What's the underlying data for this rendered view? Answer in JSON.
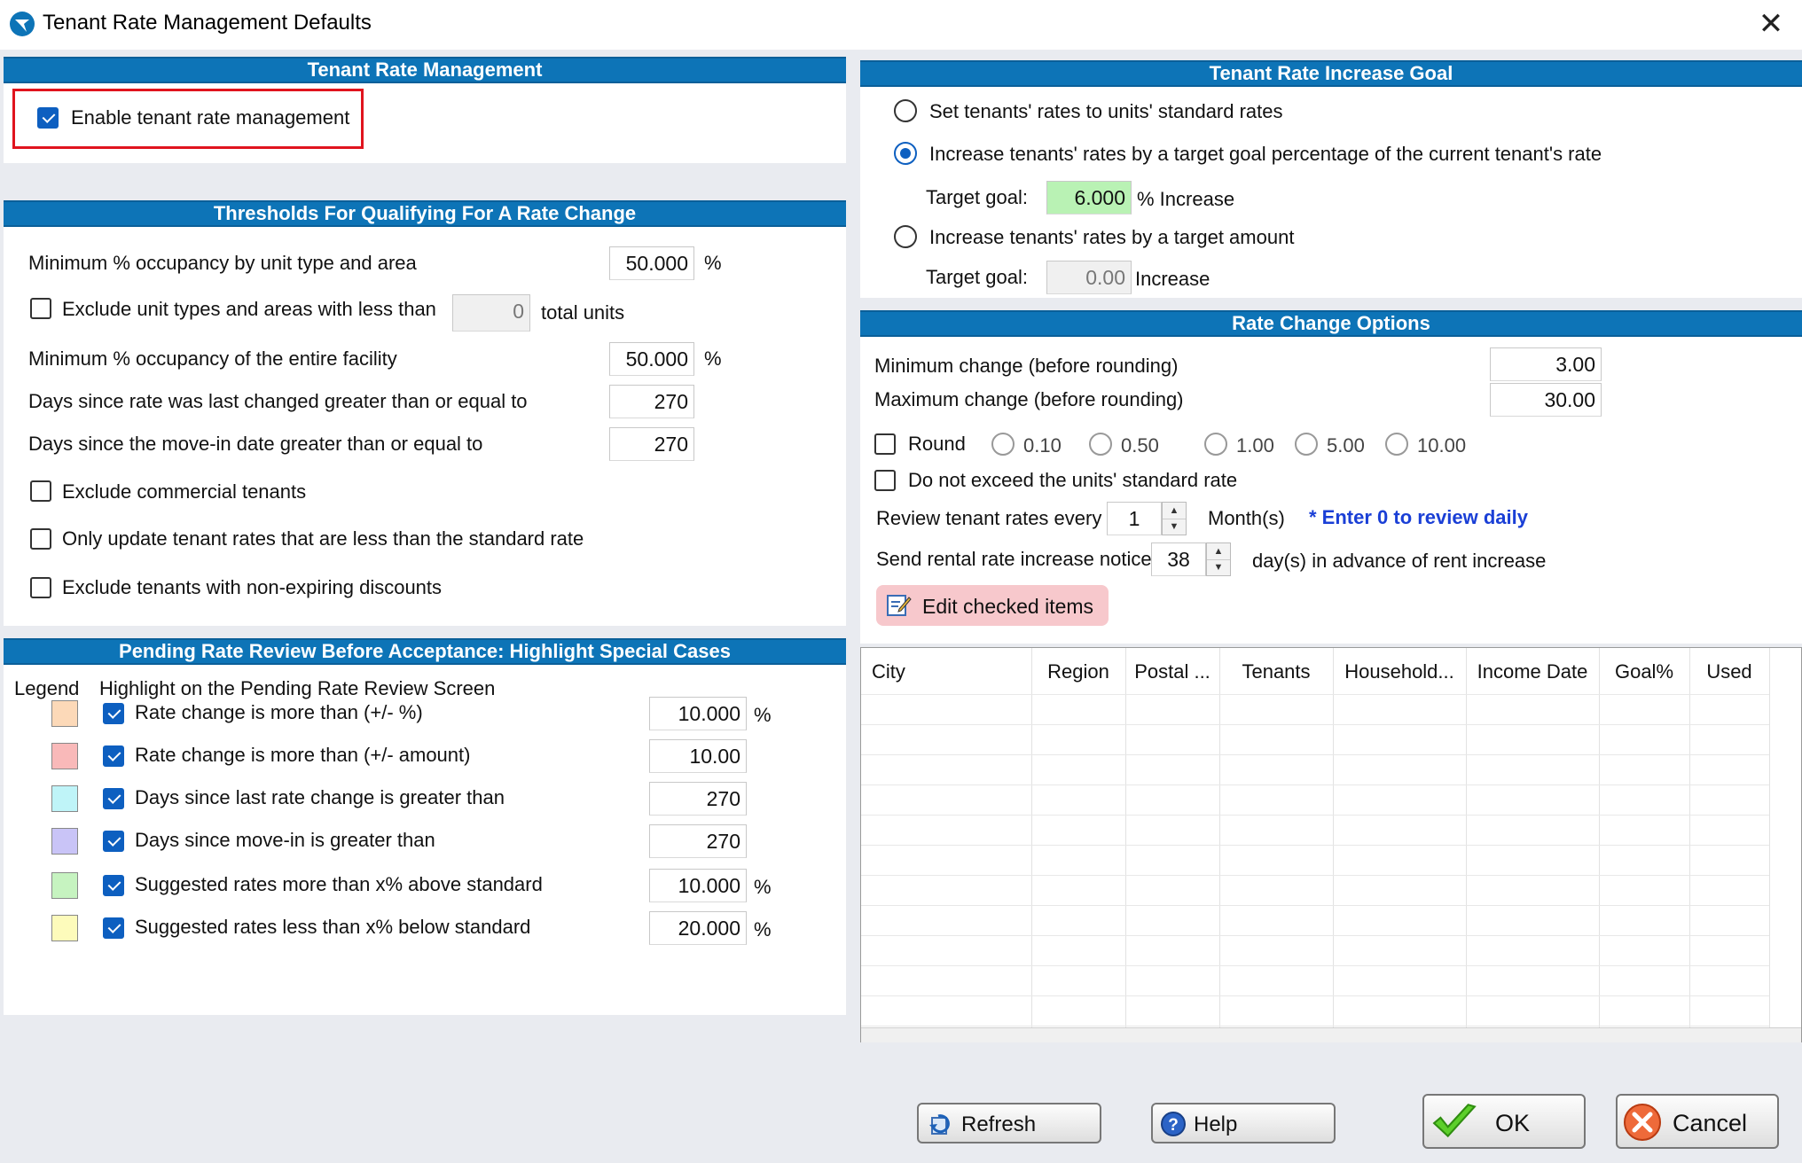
{
  "window": {
    "title": "Tenant Rate Management Defaults",
    "close": "✕"
  },
  "trm": {
    "header": "Tenant Rate Management",
    "enable_label": "Enable tenant rate management"
  },
  "thresholds": {
    "header": "Thresholds For Qualifying For A Rate Change",
    "min_occ_unit_label": "Minimum % occupancy by unit type and area",
    "min_occ_unit_value": "50.000",
    "pct": "%",
    "exclude_less_label": "Exclude unit types and areas with less than",
    "exclude_less_value": "0",
    "total_units": "total units",
    "min_occ_facility_label": "Minimum % occupancy of the entire facility",
    "min_occ_facility_value": "50.000",
    "days_rate_label": "Days since rate was last changed greater than or equal to",
    "days_rate_value": "270",
    "days_movein_label": "Days since the move-in date greater than or equal to",
    "days_movein_value": "270",
    "exclude_commercial": "Exclude commercial tenants",
    "only_update_less": "Only update tenant rates that are less than the standard rate",
    "exclude_nonexpiring": "Exclude tenants with non-expiring discounts"
  },
  "pending": {
    "header": "Pending Rate Review Before Acceptance:  Highlight Special Cases",
    "legend": "Legend",
    "highlight": "Highlight on the Pending Rate Review Screen",
    "rows": [
      {
        "label": "Rate change is more than (+/- %)",
        "value": "10.000",
        "unit": "%",
        "color": "#fcd9b8"
      },
      {
        "label": "Rate change is more than (+/- amount)",
        "value": "10.00",
        "unit": "",
        "color": "#f9b9b9"
      },
      {
        "label": "Days since last rate change is greater than",
        "value": "270",
        "unit": "",
        "color": "#bff4f8"
      },
      {
        "label": "Days since move-in is greater than",
        "value": "270",
        "unit": "",
        "color": "#c9c4f7"
      },
      {
        "label": "Suggested rates more than x% above standard",
        "value": "10.000",
        "unit": "%",
        "color": "#c6f3c0"
      },
      {
        "label": "Suggested rates less than x% below standard",
        "value": "20.000",
        "unit": "%",
        "color": "#fdfbbb"
      }
    ]
  },
  "goal": {
    "header": "Tenant Rate Increase Goal",
    "opt1": "Set tenants' rates to units' standard rates",
    "opt2": "Increase tenants' rates by a target goal percentage of the current tenant's rate",
    "target_goal": "Target goal:",
    "goal_pct_value": "6.000",
    "pct_increase": "% Increase",
    "opt3": "Increase tenants' rates by a target amount",
    "goal_amt_value": "0.00",
    "increase": "Increase"
  },
  "options": {
    "header": "Rate Change Options",
    "min_change_label": "Minimum change (before rounding)",
    "min_change_value": "3.00",
    "max_change_label": "Maximum change (before rounding)",
    "max_change_value": "30.00",
    "round": "Round",
    "round_values": [
      "0.10",
      "0.50",
      "1.00",
      "5.00",
      "10.00"
    ],
    "no_exceed": "Do not exceed the units' standard rate",
    "review_every": "Review tenant rates every",
    "review_value": "1",
    "months": "Month(s)",
    "review_hint": "* Enter 0 to review daily",
    "notice_label": "Send rental rate increase notice",
    "notice_value": "38",
    "notice_suffix": "day(s) in advance of rent increase",
    "edit_checked": "Edit checked items"
  },
  "grid": {
    "columns": [
      "City",
      "Region",
      "Postal ...",
      "Tenants",
      "Household...",
      "Income Date",
      "Goal%",
      "Used"
    ]
  },
  "buttons": {
    "refresh": "Refresh",
    "help": "Help",
    "ok": "OK",
    "cancel": "Cancel"
  },
  "colors": {
    "header_blue": "#0d74b7",
    "highlight_red": "#e0141e",
    "hint_blue": "#1a3fd6",
    "edit_btn_bg": "#f7c8cc"
  }
}
